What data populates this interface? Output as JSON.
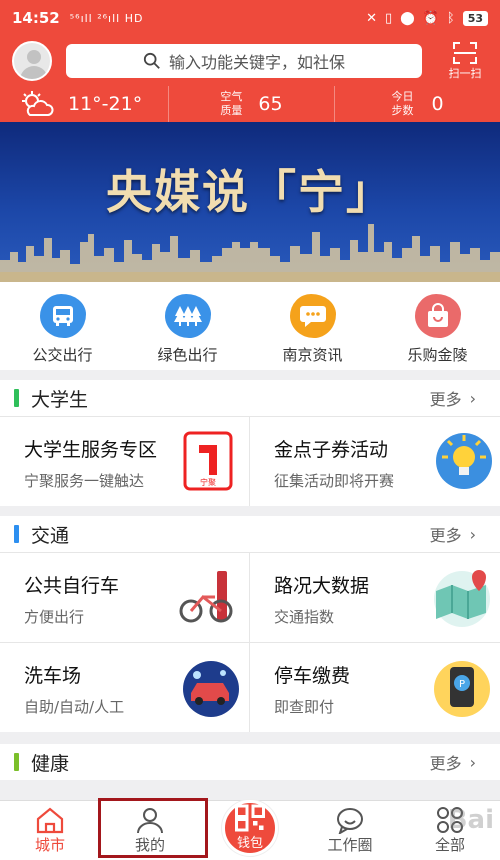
{
  "status_bar": {
    "time": "14:52",
    "signal": "⁵⁶ıll ²⁶ıll HD",
    "battery": "53"
  },
  "header": {
    "search_placeholder": "输入功能关键字，如社保",
    "scan_label": "扫一扫"
  },
  "weather": {
    "temperature": "11°-21°",
    "air_label_line1": "空气",
    "air_label_line2": "质量",
    "air_value": "65",
    "steps_label_line1": "今日",
    "steps_label_line2": "步数",
    "steps_value": "0"
  },
  "banner": {
    "title": "央媒说「宁」"
  },
  "quick_menu": [
    {
      "label": "公交出行",
      "icon": "bus-icon",
      "color": "#3a92e8"
    },
    {
      "label": "绿色出行",
      "icon": "trees-icon",
      "color": "#3a92e8"
    },
    {
      "label": "南京资讯",
      "icon": "chat-bubble-icon",
      "color": "#f5a21b"
    },
    {
      "label": "乐购金陵",
      "icon": "shopping-bag-icon",
      "color": "#ea6a6a"
    }
  ],
  "sections": [
    {
      "title": "大学生",
      "more": "更多",
      "accent": "#2fbf5a",
      "cards": [
        {
          "title": "大学生服务专区",
          "subtitle": "宁聚服务一键触达"
        },
        {
          "title": "金点子券活动",
          "subtitle": "征集活动即将开赛"
        }
      ]
    },
    {
      "title": "交通",
      "more": "更多",
      "accent": "#2d8ff0",
      "cards": [
        {
          "title": "公共自行车",
          "subtitle": "方便出行"
        },
        {
          "title": "路况大数据",
          "subtitle": "交通指数"
        },
        {
          "title": "洗车场",
          "subtitle": "自助/自动/人工"
        },
        {
          "title": "停车缴费",
          "subtitle": "即查即付"
        }
      ]
    },
    {
      "title": "健康",
      "more": "更多",
      "accent": "#7bbf2a"
    }
  ],
  "bottom_nav": {
    "city": "城市",
    "mine": "我的",
    "wallet": "钱包",
    "workspace": "工作圈",
    "all": "全部"
  },
  "watermark": "Bai",
  "colors": {
    "brand_red": "#ee4a3c"
  }
}
